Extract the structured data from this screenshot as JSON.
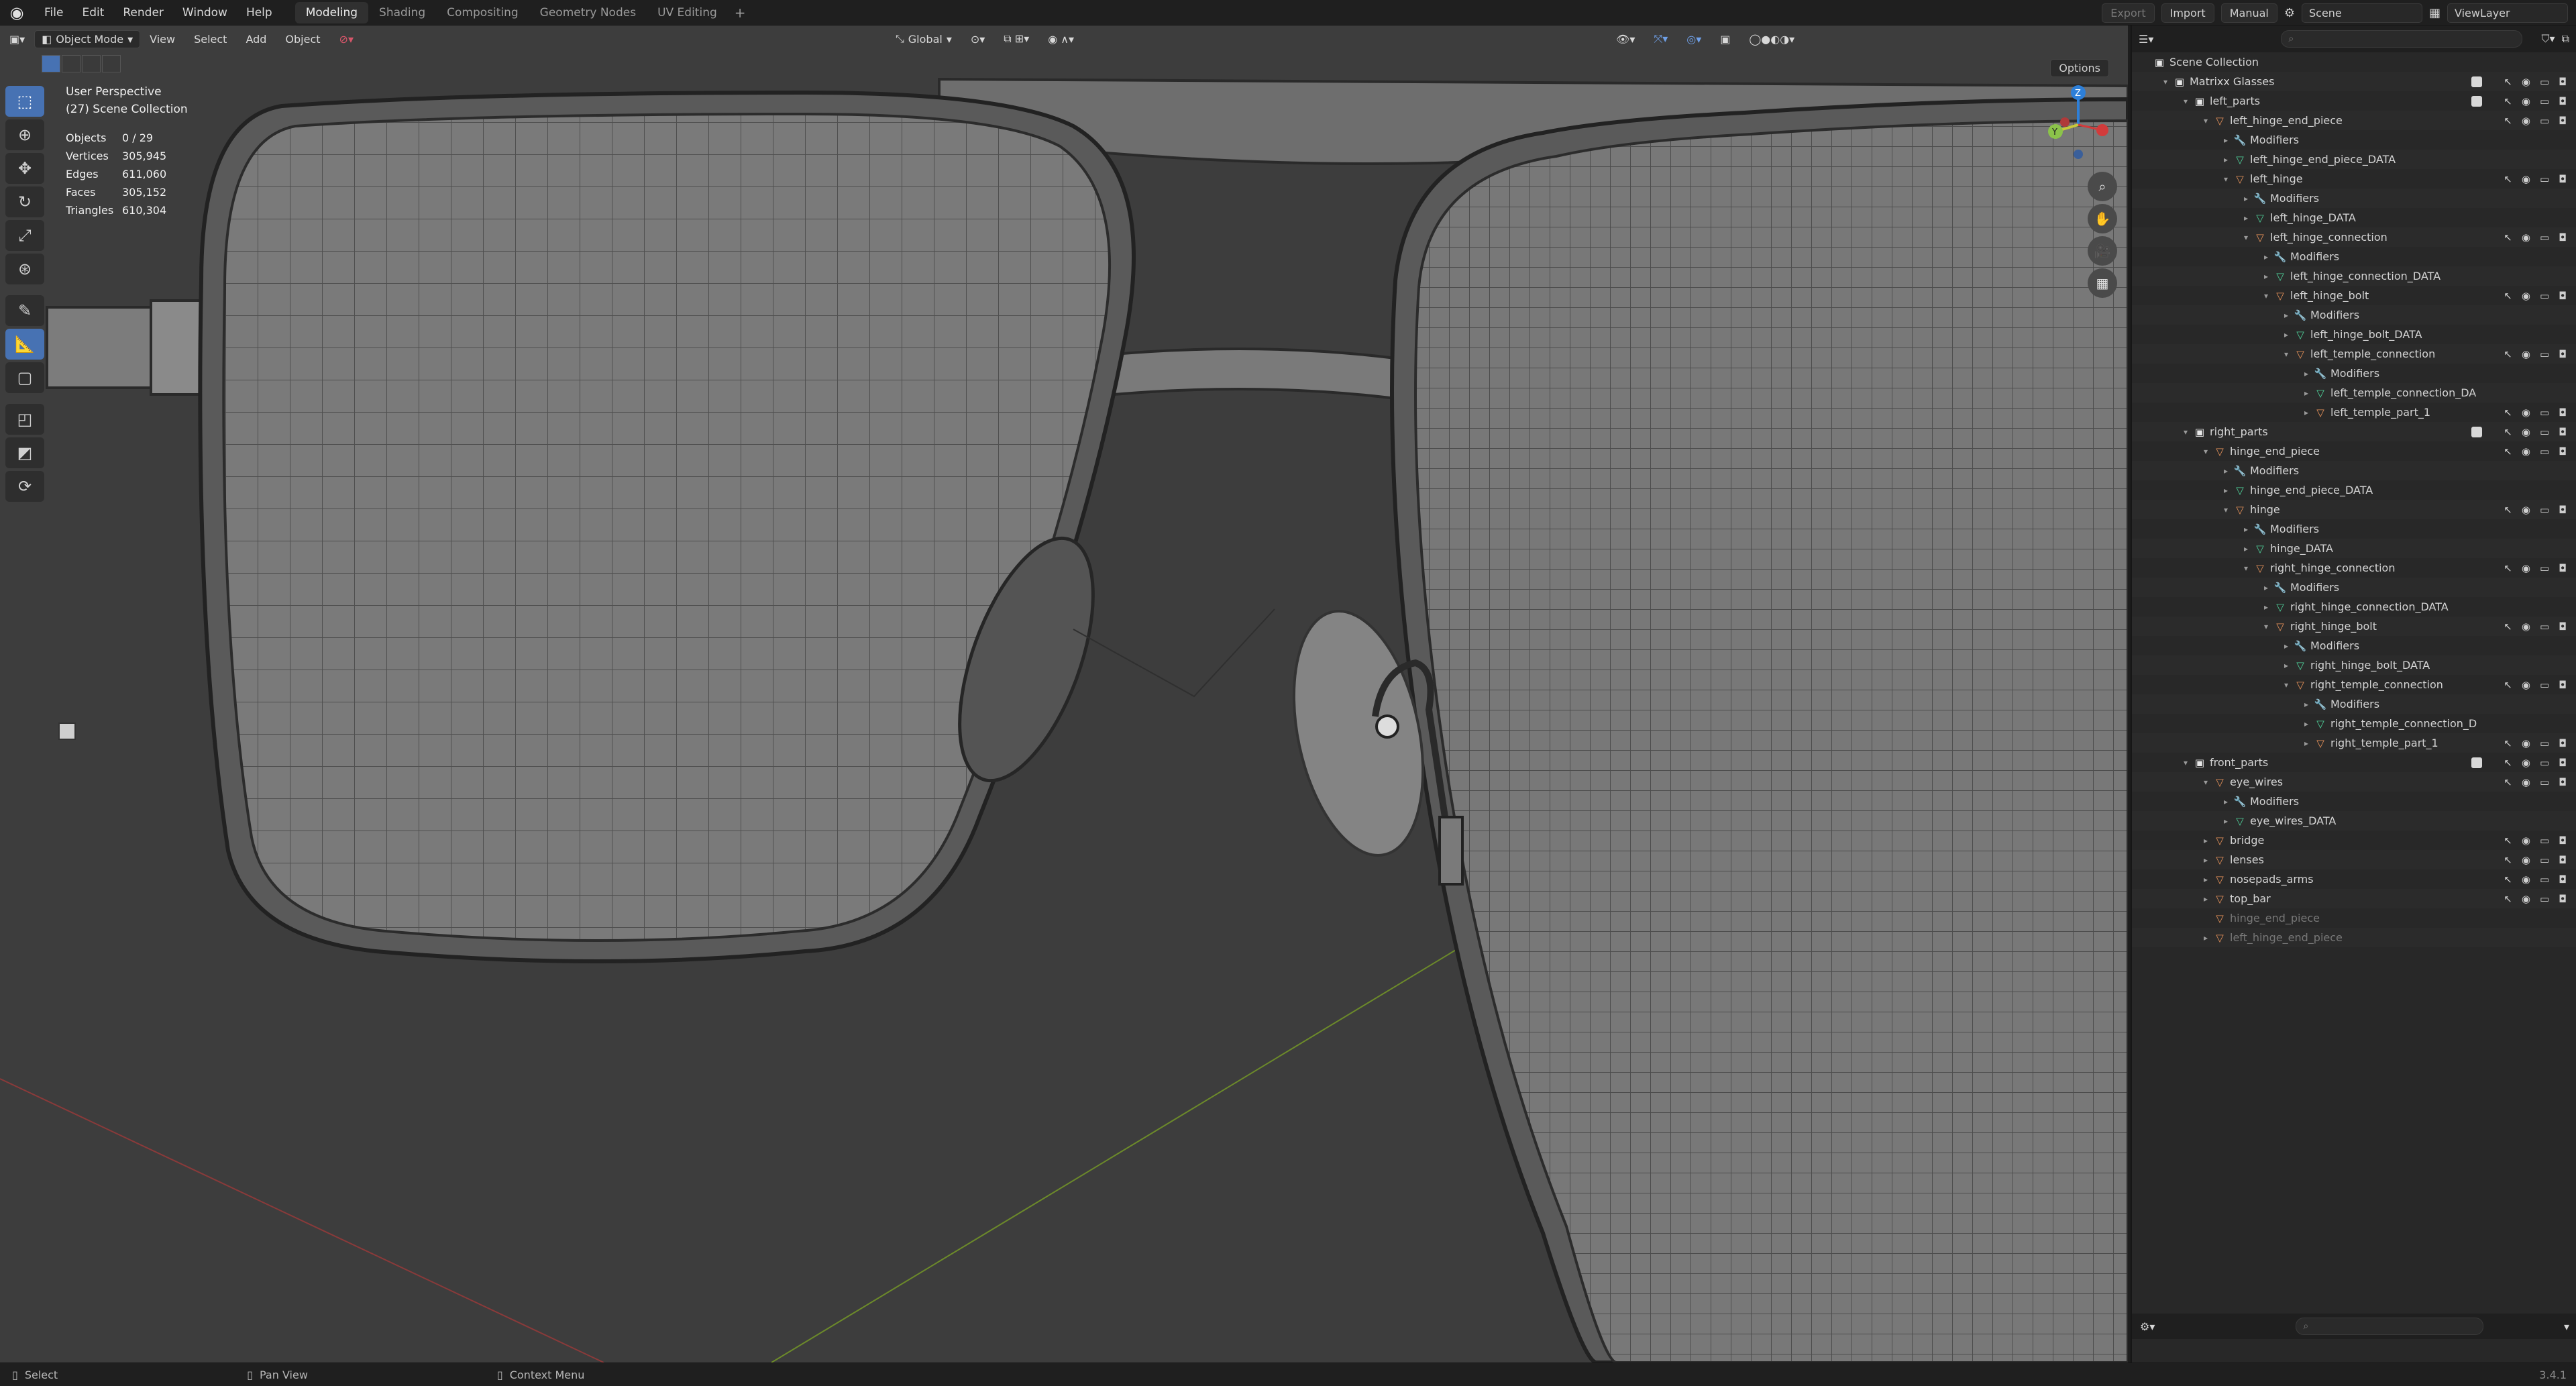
{
  "topbar": {
    "menus": [
      "File",
      "Edit",
      "Render",
      "Window",
      "Help"
    ],
    "workspaces": [
      "Modeling",
      "Shading",
      "Compositing",
      "Geometry Nodes",
      "UV Editing"
    ],
    "active_workspace": "Modeling",
    "export_label": "Export",
    "import_label": "Import",
    "manual_label": "Manual",
    "scene_name": "Scene",
    "view_layer": "ViewLayer"
  },
  "viewport_header": {
    "mode": "Object Mode",
    "menus": [
      "View",
      "Select",
      "Add",
      "Object"
    ],
    "transform_orientation": "Global",
    "options_label": "Options"
  },
  "viewport_overlay": {
    "view_name": "User Perspective",
    "collection": "(27) Scene Collection",
    "stats": [
      {
        "k": "Objects",
        "v": "0 / 29"
      },
      {
        "k": "Vertices",
        "v": "305,945"
      },
      {
        "k": "Edges",
        "v": "611,060"
      },
      {
        "k": "Faces",
        "v": "305,152"
      },
      {
        "k": "Triangles",
        "v": "610,304"
      }
    ]
  },
  "gizmo": {
    "x": "X",
    "y": "Y",
    "z": "Z"
  },
  "outliner": {
    "rows": [
      {
        "label": "Scene Collection",
        "depth": 0,
        "icon": "coll",
        "exp": ""
      },
      {
        "label": "Matrixx Glasses",
        "depth": 1,
        "icon": "coll",
        "exp": "▾"
      },
      {
        "label": "left_parts",
        "depth": 2,
        "icon": "coll",
        "exp": "▾"
      },
      {
        "label": "left_hinge_end_piece",
        "depth": 3,
        "icon": "obj",
        "exp": "▾"
      },
      {
        "label": "Modifiers",
        "depth": 4,
        "icon": "mod",
        "exp": "▸"
      },
      {
        "label": "left_hinge_end_piece_DATA",
        "depth": 4,
        "icon": "mesh",
        "exp": "▸"
      },
      {
        "label": "left_hinge",
        "depth": 4,
        "icon": "obj",
        "exp": "▾"
      },
      {
        "label": "Modifiers",
        "depth": 5,
        "icon": "mod",
        "exp": "▸"
      },
      {
        "label": "left_hinge_DATA",
        "depth": 5,
        "icon": "mesh",
        "exp": "▸"
      },
      {
        "label": "left_hinge_connection",
        "depth": 5,
        "icon": "obj",
        "exp": "▾"
      },
      {
        "label": "Modifiers",
        "depth": 6,
        "icon": "mod",
        "exp": "▸"
      },
      {
        "label": "left_hinge_connection_DATA",
        "depth": 6,
        "icon": "mesh",
        "exp": "▸"
      },
      {
        "label": "left_hinge_bolt",
        "depth": 6,
        "icon": "obj",
        "exp": "▾"
      },
      {
        "label": "Modifiers",
        "depth": 7,
        "icon": "mod",
        "exp": "▸"
      },
      {
        "label": "left_hinge_bolt_DATA",
        "depth": 7,
        "icon": "mesh",
        "exp": "▸"
      },
      {
        "label": "left_temple_connection",
        "depth": 7,
        "icon": "obj",
        "exp": "▾"
      },
      {
        "label": "Modifiers",
        "depth": 8,
        "icon": "mod",
        "exp": "▸"
      },
      {
        "label": "left_temple_connection_DA",
        "depth": 8,
        "icon": "mesh",
        "exp": "▸"
      },
      {
        "label": "left_temple_part_1",
        "depth": 8,
        "icon": "obj",
        "exp": "▸"
      },
      {
        "label": "right_parts",
        "depth": 2,
        "icon": "coll",
        "exp": "▾"
      },
      {
        "label": "hinge_end_piece",
        "depth": 3,
        "icon": "obj",
        "exp": "▾"
      },
      {
        "label": "Modifiers",
        "depth": 4,
        "icon": "mod",
        "exp": "▸"
      },
      {
        "label": "hinge_end_piece_DATA",
        "depth": 4,
        "icon": "mesh",
        "exp": "▸"
      },
      {
        "label": "hinge",
        "depth": 4,
        "icon": "obj",
        "exp": "▾"
      },
      {
        "label": "Modifiers",
        "depth": 5,
        "icon": "mod",
        "exp": "▸"
      },
      {
        "label": "hinge_DATA",
        "depth": 5,
        "icon": "mesh",
        "exp": "▸"
      },
      {
        "label": "right_hinge_connection",
        "depth": 5,
        "icon": "obj",
        "exp": "▾"
      },
      {
        "label": "Modifiers",
        "depth": 6,
        "icon": "mod",
        "exp": "▸"
      },
      {
        "label": "right_hinge_connection_DATA",
        "depth": 6,
        "icon": "mesh",
        "exp": "▸"
      },
      {
        "label": "right_hinge_bolt",
        "depth": 6,
        "icon": "obj",
        "exp": "▾"
      },
      {
        "label": "Modifiers",
        "depth": 7,
        "icon": "mod",
        "exp": "▸"
      },
      {
        "label": "right_hinge_bolt_DATA",
        "depth": 7,
        "icon": "mesh",
        "exp": "▸"
      },
      {
        "label": "right_temple_connection",
        "depth": 7,
        "icon": "obj",
        "exp": "▾"
      },
      {
        "label": "Modifiers",
        "depth": 8,
        "icon": "mod",
        "exp": "▸"
      },
      {
        "label": "right_temple_connection_D",
        "depth": 8,
        "icon": "mesh",
        "exp": "▸"
      },
      {
        "label": "right_temple_part_1",
        "depth": 8,
        "icon": "obj",
        "exp": "▸"
      },
      {
        "label": "front_parts",
        "depth": 2,
        "icon": "coll",
        "exp": "▾"
      },
      {
        "label": "eye_wires",
        "depth": 3,
        "icon": "obj",
        "exp": "▾"
      },
      {
        "label": "Modifiers",
        "depth": 4,
        "icon": "mod",
        "exp": "▸"
      },
      {
        "label": "eye_wires_DATA",
        "depth": 4,
        "icon": "mesh",
        "exp": "▸"
      },
      {
        "label": "bridge",
        "depth": 3,
        "icon": "obj",
        "exp": "▸"
      },
      {
        "label": "lenses",
        "depth": 3,
        "icon": "obj",
        "exp": "▸"
      },
      {
        "label": "nosepads_arms",
        "depth": 3,
        "icon": "obj",
        "exp": "▸"
      },
      {
        "label": "top_bar",
        "depth": 3,
        "icon": "obj",
        "exp": "▸"
      },
      {
        "label": "hinge_end_piece",
        "depth": 3,
        "icon": "obj",
        "exp": "",
        "dim": true
      },
      {
        "label": "left_hinge_end_piece",
        "depth": 3,
        "icon": "obj",
        "exp": "▸",
        "dim": true
      }
    ]
  },
  "statusbar": {
    "select": "Select",
    "pan": "Pan View",
    "context": "Context Menu",
    "version": "3.4.1"
  }
}
